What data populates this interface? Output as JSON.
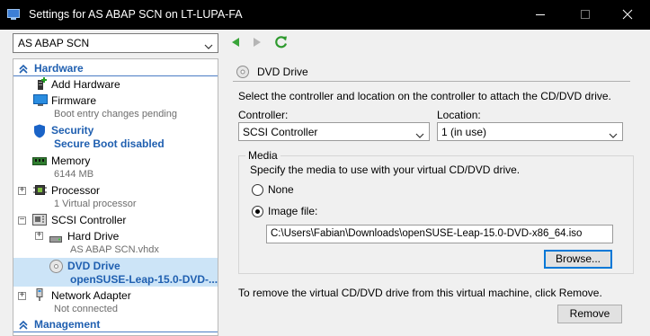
{
  "window": {
    "title": "Settings for AS ABAP SCN on LT-LUPA-FA",
    "controls": [
      "minimize",
      "maximize",
      "close"
    ]
  },
  "toolbar": {
    "vm_selected": "AS ABAP SCN",
    "icons": [
      "back-arrow-icon",
      "forward-arrow-icon",
      "refresh-icon"
    ]
  },
  "sidebar": {
    "hardware_header": "Hardware",
    "management_header": "Management",
    "items": [
      {
        "label": "Add Hardware",
        "sub": "",
        "icon": "add-hardware-icon"
      },
      {
        "label": "Firmware",
        "sub": "Boot entry changes pending",
        "icon": "firmware-icon"
      },
      {
        "label": "Security",
        "sub": "Secure Boot disabled",
        "icon": "shield-icon"
      },
      {
        "label": "Memory",
        "sub": "6144 MB",
        "icon": "memory-icon"
      },
      {
        "label": "Processor",
        "sub": "1 Virtual processor",
        "icon": "processor-icon"
      },
      {
        "label": "SCSI Controller",
        "sub": "",
        "icon": "scsi-controller-icon"
      },
      {
        "label": "Hard Drive",
        "sub": "AS ABAP SCN.vhdx",
        "icon": "hard-drive-icon"
      },
      {
        "label": "DVD Drive",
        "sub": "openSUSE-Leap-15.0-DVD-...",
        "icon": "dvd-drive-icon"
      },
      {
        "label": "Network Adapter",
        "sub": "Not connected",
        "icon": "network-adapter-icon"
      }
    ]
  },
  "panel": {
    "title": "DVD Drive",
    "description": "Select the controller and location on the controller to attach the CD/DVD drive.",
    "controller_label": "Controller:",
    "controller_value": "SCSI Controller",
    "location_label": "Location:",
    "location_value": "1 (in use)",
    "media_legend": "Media",
    "media_description": "Specify the media to use with your virtual CD/DVD drive.",
    "option_none": "None",
    "option_image": "Image file:",
    "selected_option": "Image file:",
    "image_path": "C:\\Users\\Fabian\\Downloads\\openSUSE-Leap-15.0-DVD-x86_64.iso",
    "browse_label": "Browse...",
    "remove_description": "To remove the virtual CD/DVD drive from this virtual machine, click Remove.",
    "remove_label": "Remove"
  },
  "colors": {
    "accent_blue": "#1f5fb0",
    "selection": "#cce4f7",
    "nav_green": "#3aa53a",
    "focus_border": "#0078d7"
  }
}
